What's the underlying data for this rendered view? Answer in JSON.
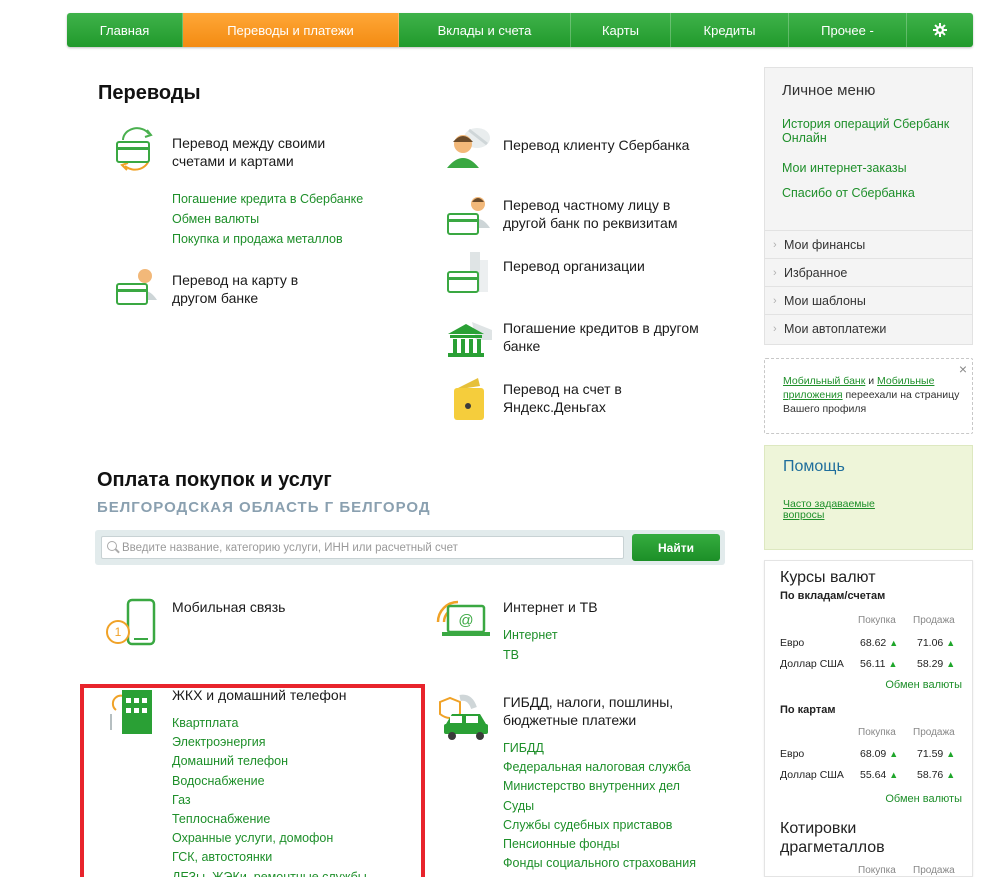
{
  "nav": {
    "items": [
      "Главная",
      "Переводы и платежи",
      "Вклады и счета",
      "Карты",
      "Кредиты",
      "Прочее -"
    ],
    "settings_icon": "gear-icon",
    "active_color": "#f38b12",
    "bar_color": "#219a2c"
  },
  "transfers": {
    "heading": "Переводы",
    "own": {
      "title": "Перевод между своими счетами и картами",
      "links": [
        "Погашение кредита в Сбербанке",
        "Обмен валюты",
        "Покупка и продажа металлов"
      ]
    },
    "card_other_bank": "Перевод на карту в другом банке",
    "sber_client": "Перевод клиенту Сбербанка",
    "private_other_bank": "Перевод частному лицу в другой банк по реквизитам",
    "organization": "Перевод организации",
    "loans_other_bank": "Погашение кредитов в другом банке",
    "yandex": "Перевод на счет в Яндекс.Деньгах"
  },
  "payments": {
    "heading": "Оплата покупок и услуг",
    "region": "БЕЛГОРОДСКАЯ ОБЛАСТЬ Г БЕЛГОРОД",
    "search_placeholder": "Введите название, категорию услуги, ИНН или расчетный счет",
    "search_button": "Найти",
    "mobile": {
      "title": "Мобильная связь"
    },
    "internet": {
      "title": "Интернет и ТВ",
      "links": [
        "Интернет",
        "ТВ"
      ]
    },
    "housing": {
      "title": "ЖКХ и домашний телефон",
      "links": [
        "Квартплата",
        "Электроэнергия",
        "Домашний телефон",
        "Водоснабжение",
        "Газ",
        "Теплоснабжение",
        "Охранные услуги, домофон",
        "ГСК, автостоянки",
        "ДЕЗы, ЖЭКи, ремонтные службы"
      ]
    },
    "gibdd": {
      "title": "ГИБДД, налоги, пошлины, бюджетные платежи",
      "links": [
        "ГИБДД",
        "Федеральная налоговая служба",
        "Министерство внутренних дел",
        "Суды",
        "Службы судебных приставов",
        "Пенсионные фонды",
        "Фонды социального страхования"
      ]
    }
  },
  "personal_menu": {
    "title": "Личное меню",
    "links": [
      "История операций Сбербанк Онлайн",
      "Мои интернет-заказы",
      "Спасибо от Сбербанка"
    ],
    "rows": [
      "Мои финансы",
      "Избранное",
      "Мои шаблоны",
      "Мои автоплатежи"
    ]
  },
  "notice": {
    "link1": "Мобильный банк",
    "and": "и",
    "link2": "Мобильные приложения",
    "rest": "переехали на страницу Вашего профиля",
    "close": "×"
  },
  "help": {
    "title": "Помощь",
    "link": "Часто задаваемые вопросы"
  },
  "rates": {
    "title": "Курсы валют",
    "deposits_label": "По вкладам/счетам",
    "cards_label": "По картам",
    "buy": "Покупка",
    "sell": "Продажа",
    "deposits": [
      {
        "currency": "Евро",
        "buy": "68.62",
        "sell": "71.06"
      },
      {
        "currency": "Доллар США",
        "buy": "56.11",
        "sell": "58.29"
      }
    ],
    "cards": [
      {
        "currency": "Евро",
        "buy": "68.09",
        "sell": "71.59"
      },
      {
        "currency": "Доллар США",
        "buy": "55.64",
        "sell": "58.76"
      }
    ],
    "exchange_link": "Обмен валюты",
    "metals_title": "Котировки драгметаллов",
    "up_arrow": "▲"
  }
}
